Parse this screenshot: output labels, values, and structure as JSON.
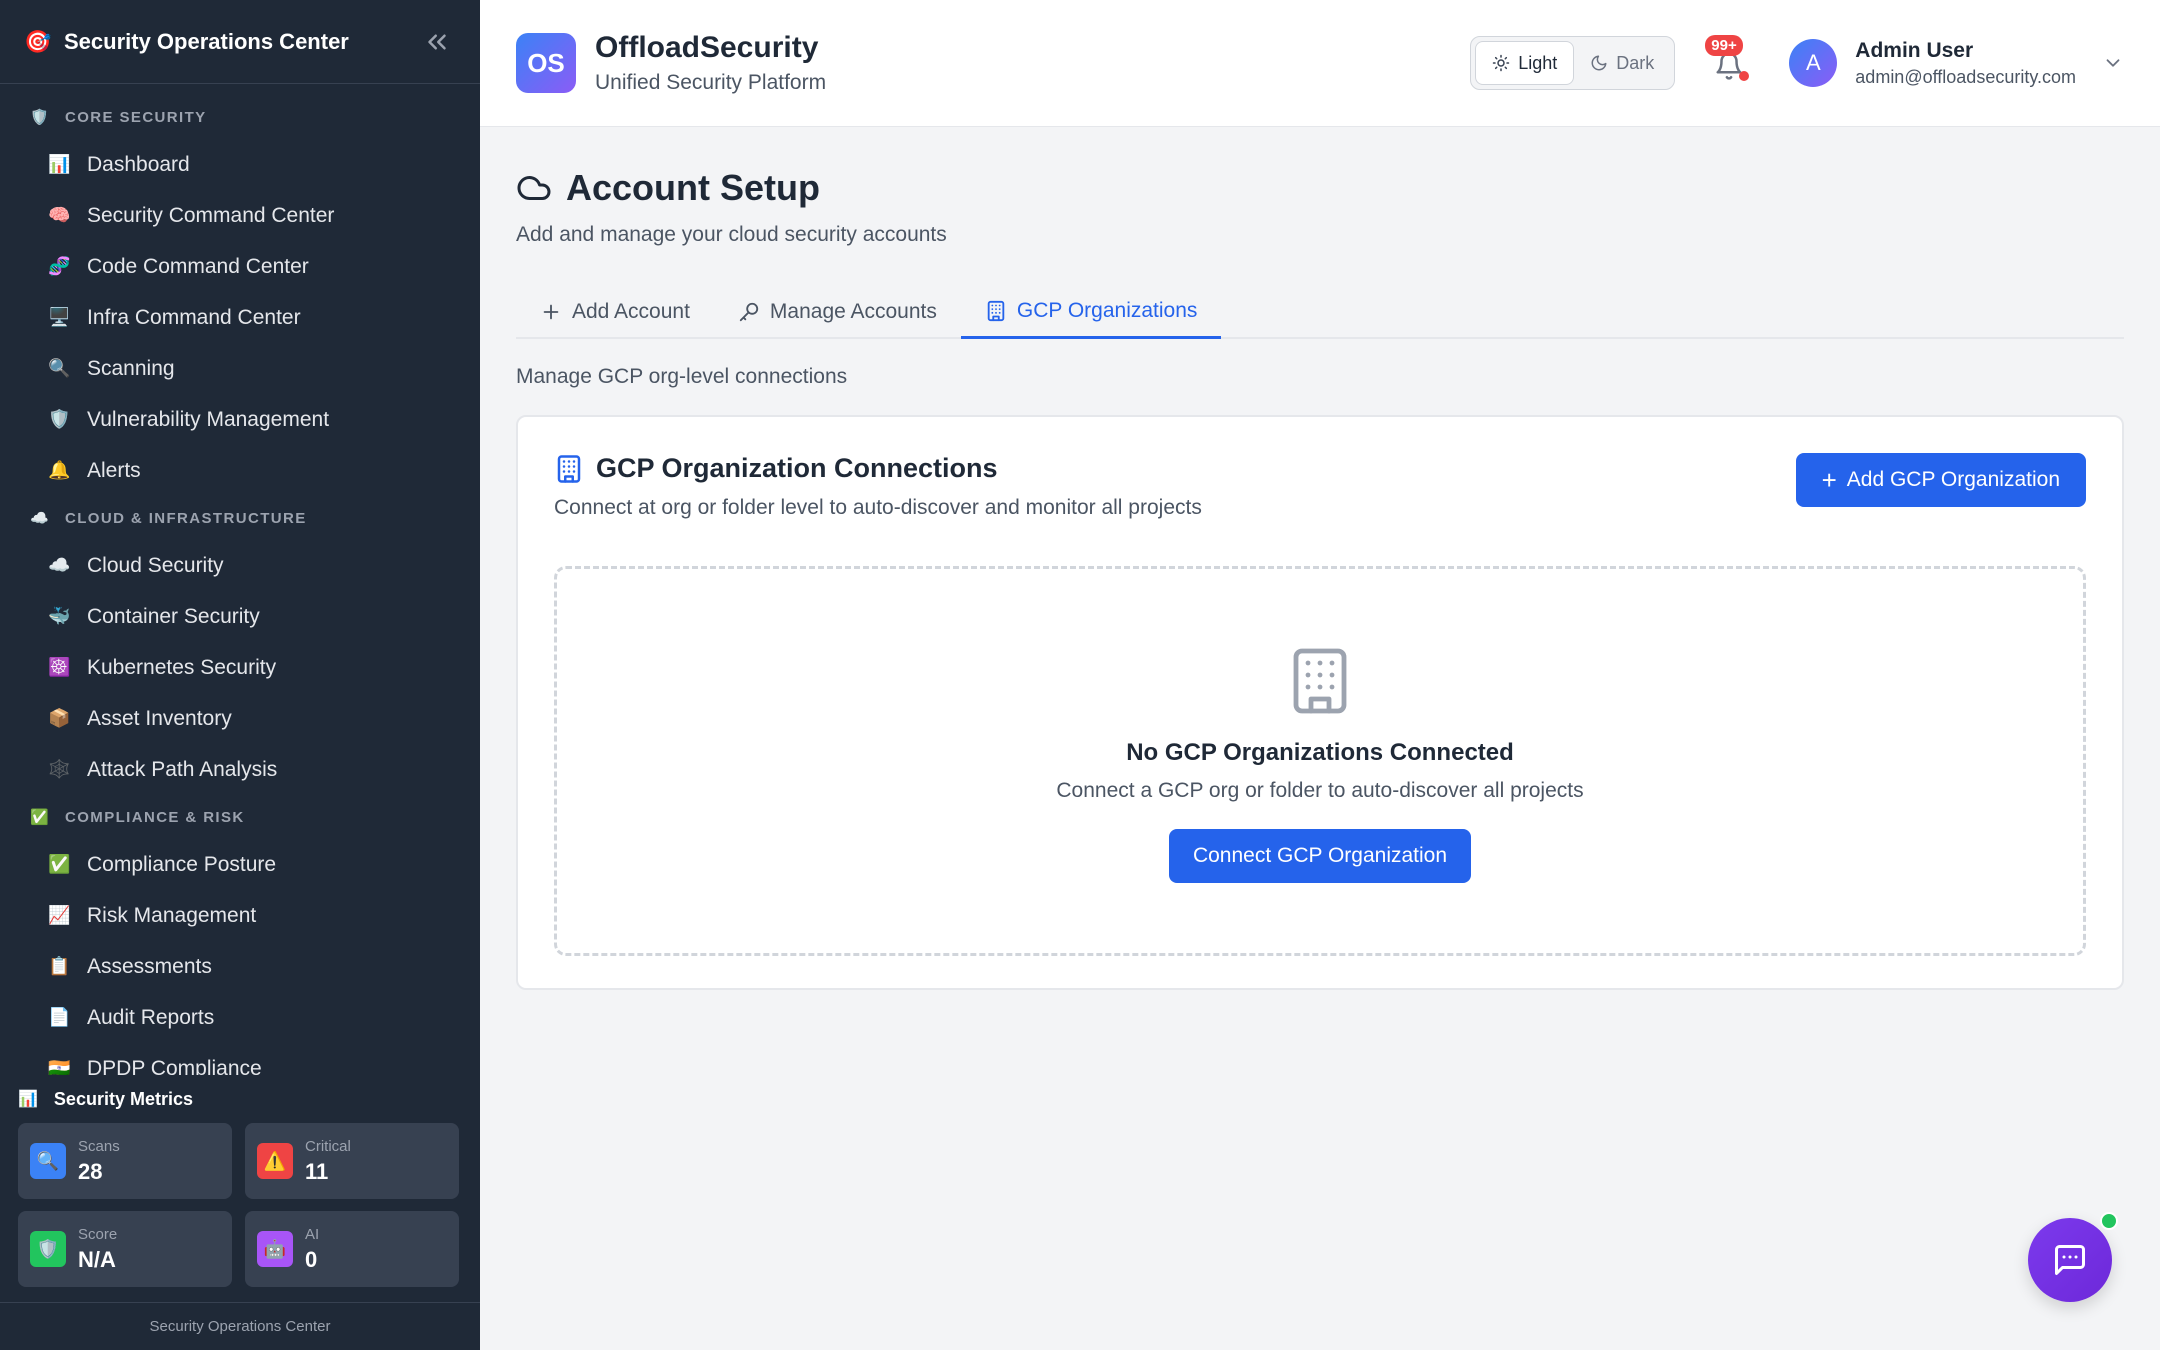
{
  "sidebar": {
    "title": "Security Operations Center",
    "logo_icon": "🎯",
    "sections": [
      {
        "label": "CORE SECURITY",
        "icon": "🛡️",
        "items": [
          {
            "label": "Dashboard",
            "icon": "📊"
          },
          {
            "label": "Security Command Center",
            "icon": "🧠"
          },
          {
            "label": "Code Command Center",
            "icon": "🧬"
          },
          {
            "label": "Infra Command Center",
            "icon": "🖥️"
          },
          {
            "label": "Scanning",
            "icon": "🔍"
          },
          {
            "label": "Vulnerability Management",
            "icon": "🛡️"
          },
          {
            "label": "Alerts",
            "icon": "🔔"
          }
        ]
      },
      {
        "label": "CLOUD & INFRASTRUCTURE",
        "icon": "☁️",
        "items": [
          {
            "label": "Cloud Security",
            "icon": "☁️"
          },
          {
            "label": "Container Security",
            "icon": "🐳"
          },
          {
            "label": "Kubernetes Security",
            "icon": "☸️"
          },
          {
            "label": "Asset Inventory",
            "icon": "📦"
          },
          {
            "label": "Attack Path Analysis",
            "icon": "🕸️"
          }
        ]
      },
      {
        "label": "COMPLIANCE & RISK",
        "icon": "✅",
        "items": [
          {
            "label": "Compliance Posture",
            "icon": "✅"
          },
          {
            "label": "Risk Management",
            "icon": "📈"
          },
          {
            "label": "Assessments",
            "icon": "📋"
          },
          {
            "label": "Audit Reports",
            "icon": "📄"
          },
          {
            "label": "DPDP Compliance",
            "icon": "🇮🇳"
          }
        ]
      }
    ],
    "metrics": {
      "title": "Security Metrics",
      "icon": "📊",
      "items": [
        {
          "label": "Scans",
          "value": "28",
          "icon": "🔍",
          "color": "#3b82f6"
        },
        {
          "label": "Critical",
          "value": "11",
          "icon": "⚠️",
          "color": "#ef4444"
        },
        {
          "label": "Score",
          "value": "N/A",
          "icon": "🛡️",
          "color": "#22c55e"
        },
        {
          "label": "AI",
          "value": "0",
          "icon": "🤖",
          "color": "#a855f7"
        }
      ]
    },
    "footer": "Security Operations Center"
  },
  "topbar": {
    "logo_text": "OS",
    "brand_name": "OffloadSecurity",
    "brand_sub": "Unified Security Platform",
    "theme": {
      "light": "Light",
      "dark": "Dark",
      "selected": "Light"
    },
    "notifications_badge": "99+",
    "user": {
      "initial": "A",
      "name": "Admin User",
      "email": "admin@offloadsecurity.com"
    }
  },
  "page": {
    "title": "Account Setup",
    "subtitle": "Add and manage your cloud security accounts",
    "tabs": [
      {
        "label": "Add Account",
        "icon": "plus-icon"
      },
      {
        "label": "Manage Accounts",
        "icon": "key-icon"
      },
      {
        "label": "GCP Organizations",
        "icon": "building-icon"
      }
    ],
    "active_tab": "GCP Organizations",
    "tab_description": "Manage GCP org-level connections",
    "card": {
      "title": "GCP Organization Connections",
      "subtitle": "Connect at org or folder level to auto-discover and monitor all projects",
      "add_button": "Add GCP Organization",
      "empty_title": "No GCP Organizations Connected",
      "empty_sub": "Connect a GCP org or folder to auto-discover all projects",
      "connect_button": "Connect GCP Organization"
    }
  },
  "colors": {
    "sidebar_bg": "#1f2937",
    "accent": "#2563eb",
    "badge": "#ef4444",
    "chat": "#7c3aed",
    "online": "#22c55e"
  }
}
